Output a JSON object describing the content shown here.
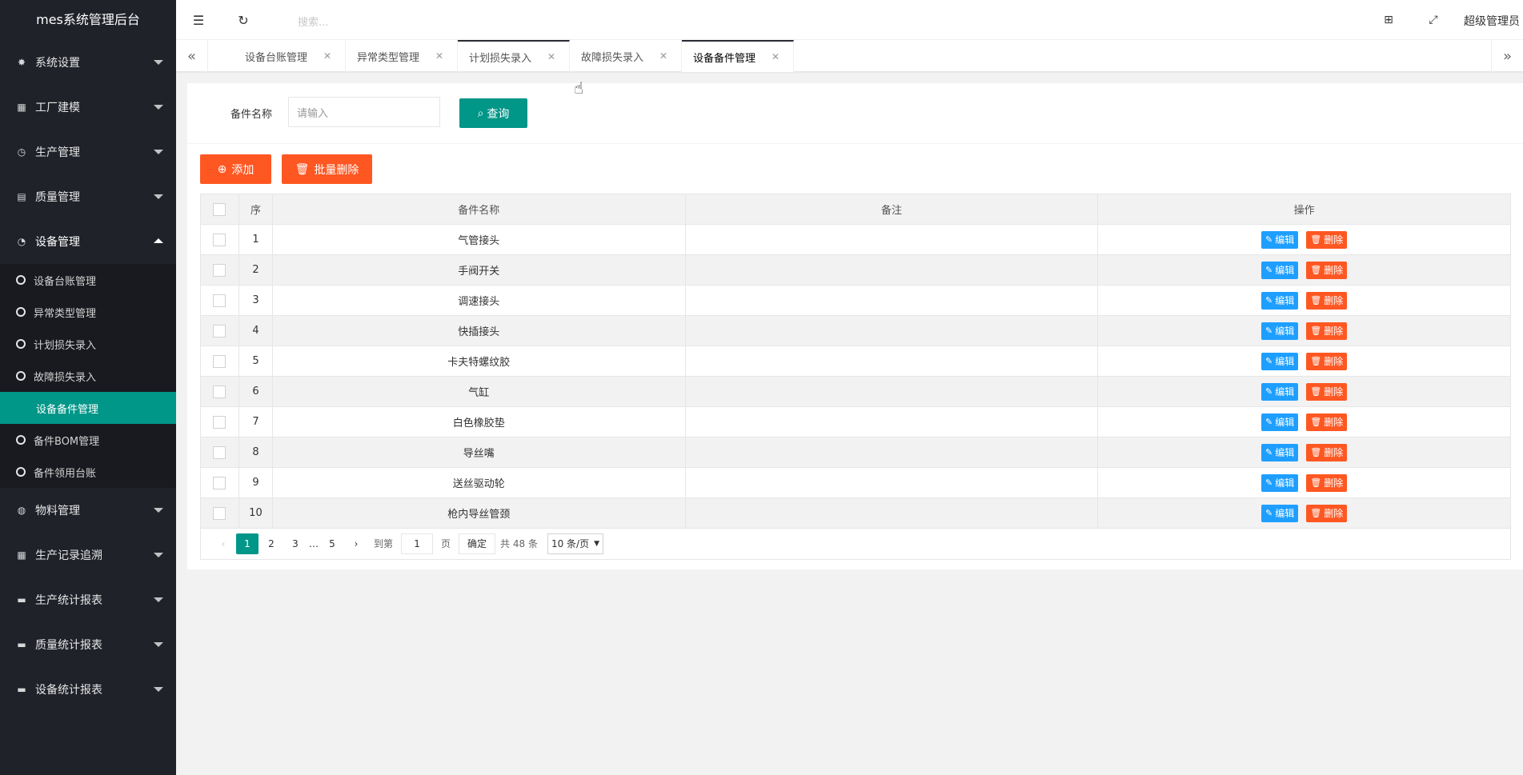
{
  "app": {
    "title": "mes系统管理后台"
  },
  "sidebar": {
    "groups": [
      {
        "label": "系统设置",
        "icon": "gear-icon"
      },
      {
        "label": "工厂建模",
        "icon": "apps-icon"
      },
      {
        "label": "生产管理",
        "icon": "clock-icon"
      },
      {
        "label": "质量管理",
        "icon": "doc-icon"
      },
      {
        "label": "设备管理",
        "icon": "dashboard-icon"
      }
    ],
    "sub_items": [
      {
        "label": "设备台账管理"
      },
      {
        "label": "异常类型管理"
      },
      {
        "label": "计划损失录入"
      },
      {
        "label": "故障损失录入"
      },
      {
        "label": "设备备件管理"
      },
      {
        "label": "备件BOM管理"
      },
      {
        "label": "备件领用台账"
      }
    ],
    "groups_after": [
      {
        "label": "物料管理",
        "icon": "globe-icon"
      },
      {
        "label": "生产记录追溯",
        "icon": "table-icon"
      },
      {
        "label": "生产统计报表",
        "icon": "monitor-icon"
      },
      {
        "label": "质量统计报表",
        "icon": "monitor-icon"
      },
      {
        "label": "设备统计报表",
        "icon": "monitor-icon"
      }
    ]
  },
  "header": {
    "search_placeholder": "搜索...",
    "user": "超级管理员"
  },
  "tabs": [
    {
      "label": "设备台账管理"
    },
    {
      "label": "异常类型管理"
    },
    {
      "label": "计划损失录入"
    },
    {
      "label": "故障损失录入"
    },
    {
      "label": "设备备件管理"
    }
  ],
  "search": {
    "label": "备件名称",
    "placeholder": "请输入",
    "query_button": "查询"
  },
  "toolbar": {
    "add_label": "添加",
    "batch_delete_label": "批量删除"
  },
  "table": {
    "headers": [
      "序",
      "备件名称",
      "备注",
      "操作"
    ],
    "edit_label": "编辑",
    "delete_label": "删除",
    "rows": [
      {
        "no": "1",
        "name": "气管接头",
        "remark": ""
      },
      {
        "no": "2",
        "name": "手阀开关",
        "remark": ""
      },
      {
        "no": "3",
        "name": "调速接头",
        "remark": ""
      },
      {
        "no": "4",
        "name": "快插接头",
        "remark": ""
      },
      {
        "no": "5",
        "name": "卡夫特螺纹胶",
        "remark": ""
      },
      {
        "no": "6",
        "name": "气缸",
        "remark": ""
      },
      {
        "no": "7",
        "name": "白色橡胶垫",
        "remark": ""
      },
      {
        "no": "8",
        "name": "导丝嘴",
        "remark": ""
      },
      {
        "no": "9",
        "name": "送丝驱动轮",
        "remark": ""
      },
      {
        "no": "10",
        "name": "枪内导丝管颈",
        "remark": ""
      }
    ]
  },
  "pagination": {
    "pages": [
      "1",
      "2",
      "3",
      "…",
      "5"
    ],
    "goto_label": "到第",
    "page_value": "1",
    "page_unit": "页",
    "confirm_label": "确定",
    "total_label": "共 48 条",
    "size_label": "10 条/页"
  },
  "colors": {
    "accent": "#009688",
    "danger": "#ff5722",
    "edit": "#1e9fff",
    "sidebar": "#20222a"
  }
}
